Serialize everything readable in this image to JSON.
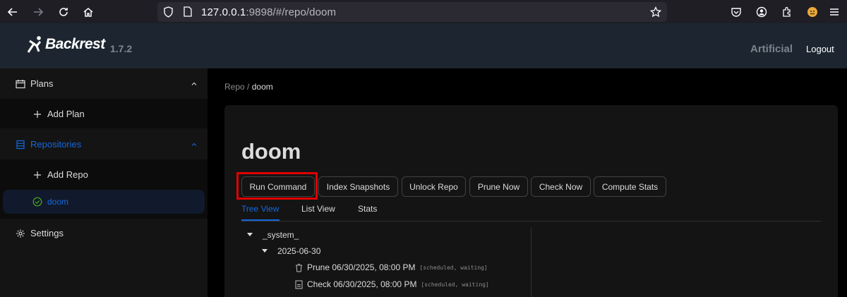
{
  "browser": {
    "url_host": "127.0.0.1",
    "url_rest": ":9898/#/repo/doom"
  },
  "header": {
    "app_name": "Backrest",
    "version": "1.7.2",
    "instance": "Artificial",
    "logout_label": "Logout"
  },
  "sidebar": {
    "plans_label": "Plans",
    "add_plan_label": "Add Plan",
    "repositories_label": "Repositories",
    "add_repo_label": "Add Repo",
    "repo_items": [
      {
        "label": "doom"
      }
    ],
    "settings_label": "Settings",
    "active_color": "#1668dc"
  },
  "breadcrumb": {
    "parent": "Repo",
    "separator": "/",
    "current": "doom"
  },
  "repo": {
    "title": "doom",
    "buttons": {
      "run_command": "Run Command",
      "index_snapshots": "Index Snapshots",
      "unlock_repo": "Unlock Repo",
      "prune_now": "Prune Now",
      "check_now": "Check Now",
      "compute_stats": "Compute Stats"
    },
    "tabs": {
      "tree_view": "Tree View",
      "list_view": "List View",
      "stats": "Stats"
    },
    "tree": {
      "root": "_system_",
      "date": "2025-06-30",
      "ops": [
        {
          "label": "Prune 06/30/2025, 08:00 PM",
          "status": "[scheduled, waiting]",
          "icon": "trash-icon"
        },
        {
          "label": "Check 06/30/2025, 08:00 PM",
          "status": "[scheduled, waiting]",
          "icon": "check-doc-icon"
        }
      ]
    }
  }
}
